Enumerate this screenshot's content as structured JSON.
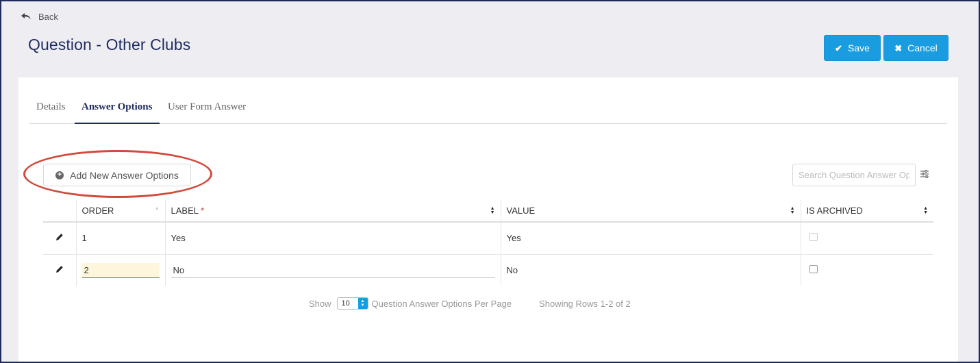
{
  "header": {
    "back_label": "Back",
    "title": "Question - Other Clubs",
    "save_label": "Save",
    "cancel_label": "Cancel"
  },
  "tabs": [
    {
      "label": "Details",
      "active": false
    },
    {
      "label": "Answer Options",
      "active": true
    },
    {
      "label": "User Form Answer",
      "active": false
    }
  ],
  "toolbar": {
    "add_label": "Add New Answer Options",
    "search_placeholder": "Search Question Answer Options"
  },
  "table": {
    "columns": [
      {
        "label": "ORDER"
      },
      {
        "label": "LABEL",
        "required_mark": "*"
      },
      {
        "label": "VALUE"
      },
      {
        "label": "IS ARCHIVED"
      }
    ],
    "rows": [
      {
        "order": "1",
        "label": "Yes",
        "value": "Yes",
        "archived": false
      },
      {
        "order": "2",
        "label": "No",
        "value": "No",
        "archived": false
      }
    ]
  },
  "pagination": {
    "show_label": "Show",
    "per_page": "10",
    "per_page_label": "Question Answer Options Per Page",
    "rows_label": "Showing Rows 1-2 of 2"
  },
  "colors": {
    "primary": "#1a9de0",
    "title": "#1f2a5e",
    "highlight": "#d24a3d"
  }
}
